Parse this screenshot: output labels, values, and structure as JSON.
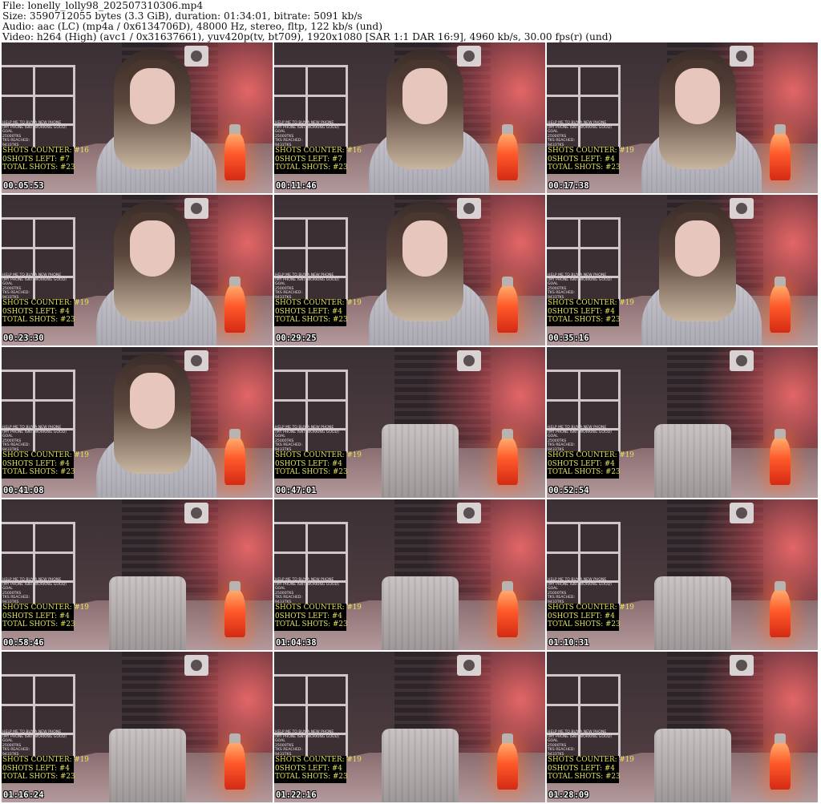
{
  "header": {
    "file": "File: lonelly_lolly98_202507310306.mp4",
    "size": "Size: 3590712055 bytes (3.3 GiB), duration: 01:34:01, bitrate: 5091 kb/s",
    "audio": "Audio: aac (LC) (mp4a / 0x6134706D), 48000 Hz, stereo, fltp, 122 kb/s (und)",
    "video": "Video: h264 (High) (avc1 / 0x31637661), yuv420p(tv, bt709), 1920x1080 [SAR 1:1 DAR 16:9], 4960 kb/s, 30.00 fps(r) (und)"
  },
  "thumbnails": [
    {
      "time": "00:05:53",
      "scene": "person",
      "shots_counter": "SHOTS COUNTER: #16",
      "shots_left": "0SHOTS LEFT: #7",
      "total_shots": "TOTAL SHOTS: #23"
    },
    {
      "time": "00:11:46",
      "scene": "person",
      "shots_counter": "SHOTS COUNTER: #16",
      "shots_left": "0SHOTS LEFT: #7",
      "total_shots": "TOTAL SHOTS: #23"
    },
    {
      "time": "00:17:38",
      "scene": "person",
      "shots_counter": "SHOTS COUNTER: #19",
      "shots_left": "0SHOTS LEFT: #4",
      "total_shots": "TOTAL SHOTS: #23"
    },
    {
      "time": "00:23:30",
      "scene": "person",
      "shots_counter": "SHOTS COUNTER: #19",
      "shots_left": "0SHOTS LEFT: #4",
      "total_shots": "TOTAL SHOTS: #23"
    },
    {
      "time": "00:29:25",
      "scene": "person",
      "shots_counter": "SHOTS COUNTER: #19",
      "shots_left": "0SHOTS LEFT: #4",
      "total_shots": "TOTAL SHOTS: #23"
    },
    {
      "time": "00:35:16",
      "scene": "person",
      "shots_counter": "SHOTS COUNTER: #19",
      "shots_left": "0SHOTS LEFT: #4",
      "total_shots": "TOTAL SHOTS: #23"
    },
    {
      "time": "00:41:08",
      "scene": "person",
      "shots_counter": "SHOTS COUNTER: #19",
      "shots_left": "0SHOTS LEFT: #4",
      "total_shots": "TOTAL SHOTS: #23"
    },
    {
      "time": "00:47:01",
      "scene": "empty",
      "shots_counter": "SHOTS COUNTER: #19",
      "shots_left": "0SHOTS LEFT: #4",
      "total_shots": "TOTAL SHOTS: #23"
    },
    {
      "time": "00:52:54",
      "scene": "empty",
      "shots_counter": "SHOTS COUNTER: #19",
      "shots_left": "0SHOTS LEFT: #4",
      "total_shots": "TOTAL SHOTS: #23"
    },
    {
      "time": "00:58:46",
      "scene": "empty",
      "shots_counter": "SHOTS COUNTER: #19",
      "shots_left": "0SHOTS LEFT: #4",
      "total_shots": "TOTAL SHOTS: #23"
    },
    {
      "time": "01:04:38",
      "scene": "empty",
      "shots_counter": "SHOTS COUNTER: #19",
      "shots_left": "0SHOTS LEFT: #4",
      "total_shots": "TOTAL SHOTS: #23"
    },
    {
      "time": "01:10:31",
      "scene": "empty",
      "shots_counter": "SHOTS COUNTER: #19",
      "shots_left": "0SHOTS LEFT: #4",
      "total_shots": "TOTAL SHOTS: #23"
    },
    {
      "time": "01:16:24",
      "scene": "empty",
      "shots_counter": "SHOTS COUNTER: #19",
      "shots_left": "0SHOTS LEFT: #4",
      "total_shots": "TOTAL SHOTS: #23"
    },
    {
      "time": "01:22:16",
      "scene": "empty",
      "shots_counter": "SHOTS COUNTER: #19",
      "shots_left": "0SHOTS LEFT: #4",
      "total_shots": "TOTAL SHOTS: #23"
    },
    {
      "time": "01:28:09",
      "scene": "empty",
      "shots_counter": "SHOTS COUNTER: #19",
      "shots_left": "0SHOTS LEFT: #4",
      "total_shots": "TOTAL SHOTS: #23"
    }
  ],
  "overlay_small_lines": [
    "HELP ME TO BUY A NEW PHONE",
    "(MY PHONE ISNT WORKING GOOD)",
    "GOAL",
    "25000TKS",
    "TKS REACHED:",
    "9433TKS"
  ]
}
